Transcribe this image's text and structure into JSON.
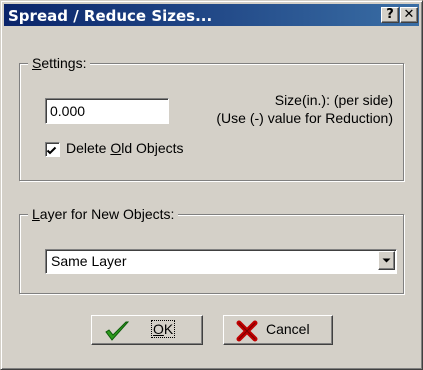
{
  "window": {
    "title": "Spread / Reduce Sizes...",
    "help_label": "?",
    "close_label": "✕"
  },
  "settings": {
    "legend_key": "S",
    "legend_rest": "ettings:",
    "size_value": "0.000",
    "size_label_line1": "Size(in.): (per side)",
    "size_label_line2": "(Use (-) value for Reduction)",
    "delete_checked": true,
    "delete_label_pre": "Delete ",
    "delete_label_key": "O",
    "delete_label_post": "ld Objects"
  },
  "layer": {
    "legend_key": "L",
    "legend_rest": "ayer for New Objects:",
    "selected": "Same Layer"
  },
  "buttons": {
    "ok_key": "O",
    "ok_rest": "K",
    "cancel_label": "Cancel"
  },
  "colors": {
    "title_gradient_start": "#0a246a",
    "title_gradient_end": "#3a6ea5",
    "face": "#d4d0c8",
    "ok_check": "#2e9b1e",
    "cancel_x": "#c00000"
  },
  "icons": {
    "ok": "green-checkmark-icon",
    "cancel": "red-x-icon",
    "checkbox": "checkmark-icon",
    "combo": "down-arrow-icon"
  }
}
